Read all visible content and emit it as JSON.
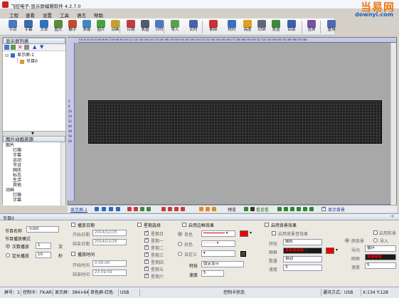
{
  "window": {
    "title": "飞控电子-显示屏编辑软件 4.2.7.0"
  },
  "watermark": {
    "line1": "当易网",
    "line2": "downyi.com"
  },
  "menu": [
    "工程",
    "查看",
    "设置",
    "工具",
    "语言",
    "帮助"
  ],
  "toolbar": [
    {
      "label": "节目",
      "icon": "program-icon",
      "color": "#4a78c8"
    },
    {
      "label": "字幕",
      "icon": "subtitle-icon",
      "color": "#3a6ab0"
    },
    {
      "label": "文本",
      "icon": "text-icon",
      "color": "#3070c0"
    },
    {
      "label": "图文",
      "icon": "image-text-icon",
      "color": "#5a8a3a"
    },
    {
      "label": "触字",
      "icon": "touch-text-icon",
      "color": "#c84a2a"
    },
    {
      "label": "表格",
      "icon": "table-icon",
      "color": "#3a88c8"
    },
    {
      "label": "图片",
      "icon": "picture-icon",
      "color": "#48a040"
    },
    {
      "label": "动画",
      "icon": "animation-icon",
      "color": "#c8a030"
    },
    {
      "label": "日期",
      "icon": "date-icon",
      "color": "#c83a3a"
    },
    {
      "label": "表盘",
      "icon": "clock-dial-icon",
      "color": "#505a70"
    },
    {
      "label": "计时",
      "icon": "timer-icon",
      "color": "#4a7ac0"
    },
    {
      "label": "导入",
      "icon": "import-icon",
      "color": "#5aa050"
    },
    {
      "label": "实时",
      "icon": "realtime-icon",
      "color": "#4a60b0"
    },
    {
      "label": "删除",
      "icon": "delete-icon",
      "color": "#d03030"
    },
    {
      "label": "校时",
      "icon": "sync-time-icon",
      "color": "#3a70c0"
    },
    {
      "label": "亮度",
      "icon": "brightness-icon",
      "color": "#e0a020"
    },
    {
      "label": "USB",
      "icon": "usb-icon",
      "color": "#606878"
    },
    {
      "label": "发送",
      "icon": "send-icon",
      "color": "#3a8a3a"
    },
    {
      "label": "回读",
      "icon": "readback-icon",
      "color": "#3a60a8"
    },
    {
      "label": "查屏",
      "icon": "check-screen-icon",
      "color": "#7a50a0"
    },
    {
      "label": "重排",
      "icon": "rearrange-icon",
      "color": "#4a6ab0"
    }
  ],
  "display_list": {
    "title": "显示屏列表",
    "screen": "显示屏-1",
    "program": "节目0"
  },
  "resources": {
    "title": "图片动画资源",
    "items": [
      "图片",
      "灯箱",
      "字幕",
      "运动",
      "节日",
      "国庆",
      "标志",
      "生活",
      "其他",
      "动画",
      "灯箱",
      "字幕"
    ]
  },
  "ruler_top": "0 8 16 24 32 40 48 56 64 72 80 88 96 104 112 120 128 136 144 152 160 168 176 184 192 200 208 216 224 232 240 248 256 264 272 280 288 296 304 312 320 328 336 344 352 360 368 376 384",
  "ruler_left": [
    "0",
    "8",
    "16",
    "24",
    "32",
    "40",
    "48",
    "56",
    "64"
  ],
  "canvas_toolbar": {
    "screen_label": "显示屏-1",
    "preview": "预览",
    "viewall": "看查看",
    "show_bg": "显示背景"
  },
  "properties": {
    "title": "节目0",
    "name_label": "节目名称",
    "name_value": "节目0",
    "play_mode_label": "节目播放模式",
    "mode_count": "次数播放",
    "count_value": "1",
    "count_unit": "次",
    "mode_fixed": "定长播放",
    "fixed_value": "10",
    "fixed_unit": "秒",
    "play_date": "播放日期",
    "start_date_label": "开始日期",
    "start_date": "2014/12/25",
    "end_date_label": "结束日期",
    "end_date": "2014/12/25",
    "play_time": "播放时间",
    "start_time_label": "开始时间",
    "start_time": "0:00:00",
    "end_time_label": "结束时间",
    "end_time": "23:59:59",
    "week_title": "星期选择",
    "weekdays": [
      "星期日",
      "星期一",
      "星期二",
      "星期三",
      "星期四",
      "星期五",
      "星期六"
    ],
    "border_title": "启用边框效果",
    "border_single": "单色",
    "border_multi": "炫色",
    "border_custom": "自定义",
    "border_effect_label": "特技",
    "border_effect": "固定显示",
    "border_speed_label": "速度",
    "border_speed": "5",
    "border_color": "#ee0000",
    "bg_title": "启用背景效果",
    "bg_sub": "启用背景音效果",
    "bg_effect_label": "特效",
    "bg_effect": "随机",
    "bg_pic_label": "图框",
    "bg_count_label": "数量",
    "bg_count": "自动",
    "bg_speed_label": "速度",
    "bg_speed": "3",
    "bg_color": "#ee0000",
    "r_bg_label": "颜背景",
    "r_lead": "导入",
    "r_loop_label": "导向",
    "r_loop": "循环",
    "r_pic_label": "图框",
    "r_speed_label": "速度",
    "r_speed": "5",
    "r_top": "启用前景"
  },
  "status": {
    "screen": "屏号：1",
    "card": "控制卡：FK-AR3",
    "size": "显示屏：384×64",
    "color": "单色屏-红色",
    "port": "USB",
    "card_state": "控制卡状态",
    "comm": "通讯方式：USB",
    "xy": "X:134 Y:128"
  }
}
